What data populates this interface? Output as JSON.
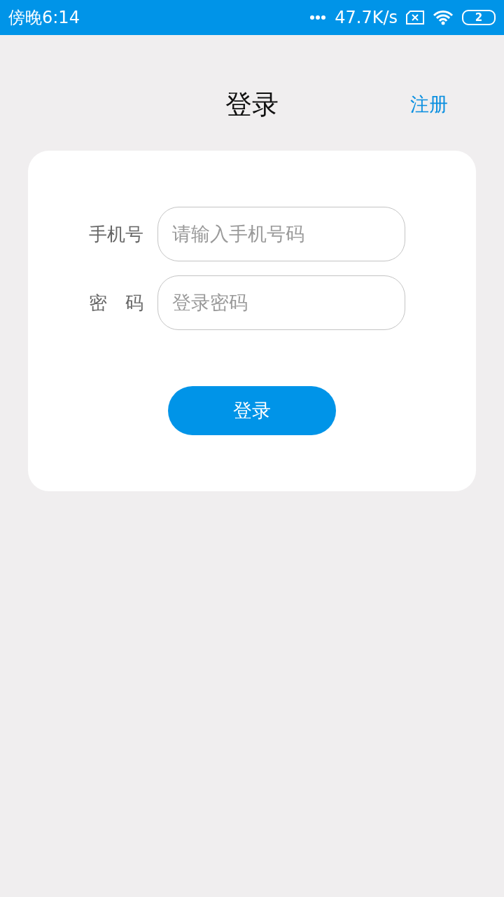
{
  "status_bar": {
    "time": "傍晚6:14",
    "network_speed": "47.7K/s",
    "battery": "2"
  },
  "header": {
    "title": "登录",
    "action": "注册"
  },
  "form": {
    "fields": [
      {
        "label": "手机号",
        "placeholder": "请输入手机号码"
      },
      {
        "label": "密　码",
        "placeholder": "登录密码"
      }
    ],
    "submit": "登录"
  }
}
